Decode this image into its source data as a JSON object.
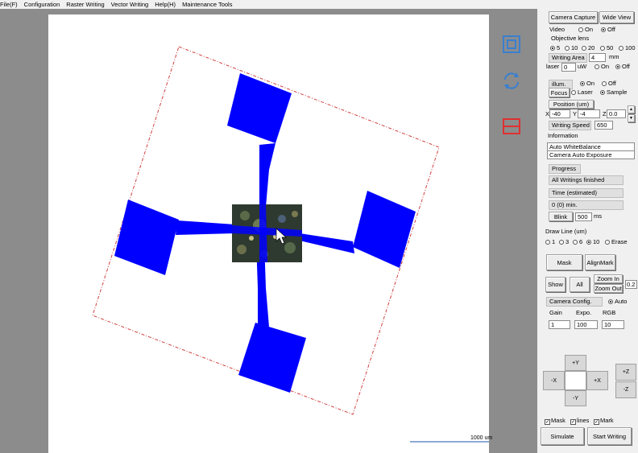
{
  "menu": [
    "File(F)",
    "Configuration",
    "Raster Writing",
    "Vector Writing",
    "Help(H)",
    "Maintenance Tools"
  ],
  "canvas": {
    "scale_label": "1000 um"
  },
  "panel": {
    "camera_capture": "Camera Capture",
    "wide_view": "Wide View",
    "video_label": "Video",
    "video_on": "On",
    "video_off": "Off",
    "objective_label": "Objective lens",
    "objective_options": [
      "5",
      "10",
      "20",
      "50",
      "100"
    ],
    "writing_area_label": "Writing Area",
    "writing_area_value": "4",
    "writing_area_unit": "mm",
    "laser_label": "laser",
    "laser_value": "0",
    "laser_unit": "uW",
    "laser_on": "On",
    "laser_off": "Off",
    "illum_label": "illum.",
    "illum_on": "On",
    "illum_off": "Off",
    "focus_label": "Focus",
    "focus_laser": "Laser",
    "focus_sample": "Sample",
    "position_label": "Position (um)",
    "x_label": "X",
    "x_value": "-40",
    "y_label": "Y",
    "y_value": "-4",
    "z_label": "Z",
    "z_value": "0.0",
    "writing_speed_label": "Writing Speed",
    "writing_speed_value": "650",
    "information_label": "Information",
    "info_lines": [
      "Auto WhiteBalance",
      "Camera Auto Exposure"
    ],
    "progress_label": "Progress",
    "progress_status": "All Writings finished",
    "time_label": "Time (estimated)",
    "time_value": "0 (0) min.",
    "blink_label": "Blink",
    "blink_value": "500",
    "blink_unit": "ms",
    "draw_line_label": "Draw Line (um)",
    "draw_line_options": [
      "1",
      "3",
      "6",
      "10",
      "Erase"
    ],
    "mask_button": "Mask",
    "alignmark_button": "AlignMark",
    "show_button": "Show",
    "all_button": "All",
    "zoom_in": "Zoom In",
    "zoom_out": "Zoom Out",
    "zoom_value": "0.2",
    "camera_config_label": "Camera Config.",
    "auto_label": "Auto",
    "gain_label": "Gain",
    "expo_label": "Expo.",
    "rgb_label": "RGB",
    "gain_value": "1",
    "expo_value": "100",
    "rgb_value": "10",
    "jog": {
      "plus_y": "+Y",
      "minus_y": "-Y",
      "minus_x": "-X",
      "plus_x": "+X",
      "plus_z": "+Z",
      "minus_z": "-Z"
    },
    "mask_chk": "Mask",
    "lines_chk": "lines",
    "mark_chk": "Mark",
    "simulate_button": "Simulate",
    "start_writing_button": "Start Writing"
  },
  "colors": {
    "pattern": "#0000ff",
    "boundary": "#d04040",
    "workspace": "#8c8c8c",
    "icon_blue": "#3a7fd0",
    "icon_red": "#e03030"
  }
}
